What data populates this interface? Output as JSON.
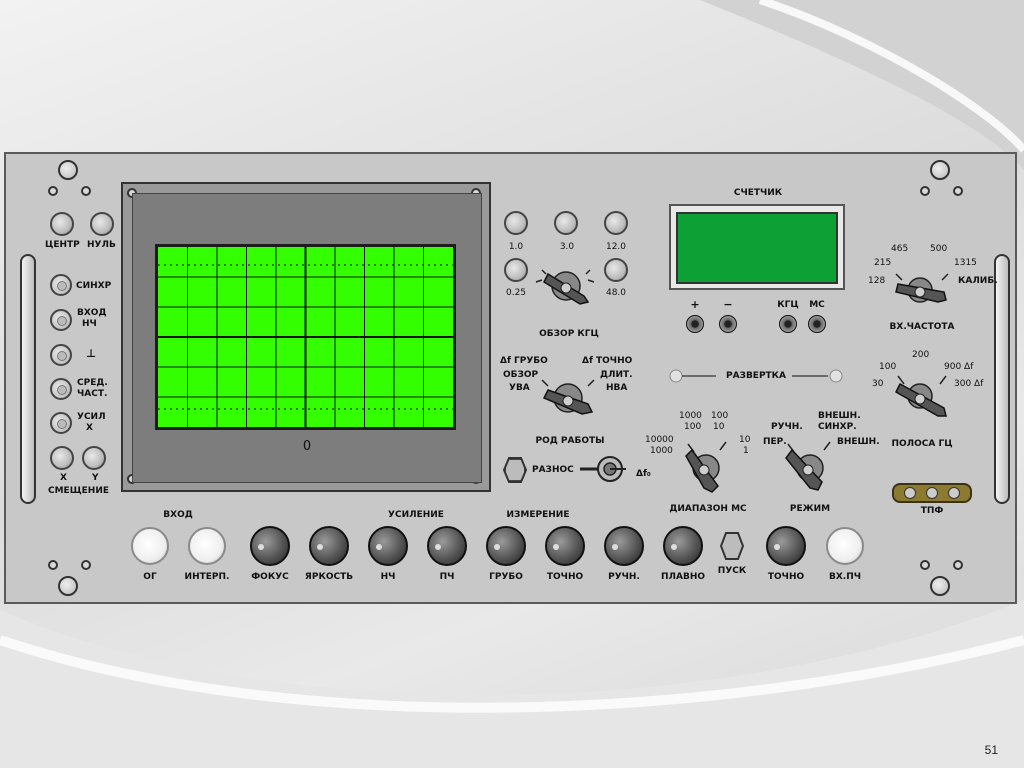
{
  "colors": {
    "screen": "#33ff00",
    "lcd": "#0da035",
    "panel": "#c8c8c8",
    "filter_plate": "#8b7a30"
  },
  "left_column": {
    "center": "ЦЕНТР",
    "zero": "НУЛЬ",
    "sync": "СИНХР",
    "lf_input_1": "ВХОД",
    "lf_input_2": "НЧ",
    "ground": "⊥",
    "mid_freq_1": "СРЕД.",
    "mid_freq_2": "ЧАСТ.",
    "amp_x_1": "УСИЛ",
    "amp_x_2": "X",
    "x": "X",
    "y": "Y",
    "offset": "СМЕЩЕНИЕ"
  },
  "screen": {
    "zero_label": "0"
  },
  "overview": {
    "ranges": [
      "1.0",
      "3.0",
      "12.0",
      "0.25",
      "48.0"
    ],
    "title": "ОБЗОР КГЦ"
  },
  "mode": {
    "coarse": "Δf ГРУБО",
    "fine": "Δf ТОЧНО",
    "overview_1": "ОБЗОР",
    "overview_2": "УВА",
    "long_1": "ДЛИТ.",
    "long_2": "НВА",
    "title": "РОД РАБОТЫ",
    "diff": "РАЗНОС",
    "delta_f0": "Δf₀"
  },
  "counter": {
    "title": "СЧЕТЧИК",
    "plus": "+",
    "minus": "−",
    "khz": "КГЦ",
    "ms": "МС"
  },
  "sweep": {
    "title": "РАЗВЕРТКА"
  },
  "range_ms": {
    "v1000": "1000",
    "v100a": "100",
    "v100b": "100",
    "v10a": "10",
    "v10000": "10000",
    "v1000b": "1000",
    "v10b": "10",
    "v1": "1",
    "title": "ДИАПАЗОН МС"
  },
  "regime": {
    "manual": "РУЧН.",
    "ext_sync_1": "ВНЕШН.",
    "ext_sync_2": "СИНХР.",
    "per": "ПЕР.",
    "ext": "ВНЕШН.",
    "title": "РЕЖИМ"
  },
  "in_freq": {
    "v465": "465",
    "v500": "500",
    "v215": "215",
    "v1315": "1315",
    "v128": "128",
    "calib": "КАЛИБ.",
    "title": "ВХ.ЧАСТОТА"
  },
  "bandwidth": {
    "v200": "200",
    "v100": "100",
    "v900": "900 Δf",
    "v30": "30",
    "v300": "300 Δf",
    "title": "ПОЛОСА ГЦ"
  },
  "tpf": {
    "title": "ТПФ"
  },
  "bottom": {
    "input_group": "ВХОД",
    "gain_group": "УСИЛЕНИЕ",
    "measure_group": "ИЗМЕРЕНИЕ",
    "og": "ОГ",
    "interp": "ИНТЕРП.",
    "focus": "ФОКУС",
    "brightness": "ЯРКОСТЬ",
    "lf": "НЧ",
    "if": "ПЧ",
    "coarse": "ГРУБО",
    "fine": "ТОЧНО",
    "manual": "РУЧН.",
    "smooth": "ПЛАВНО",
    "start": "ПУСК",
    "fine2": "ТОЧНО",
    "in_if": "ВХ.ПЧ"
  },
  "page_number": "51"
}
